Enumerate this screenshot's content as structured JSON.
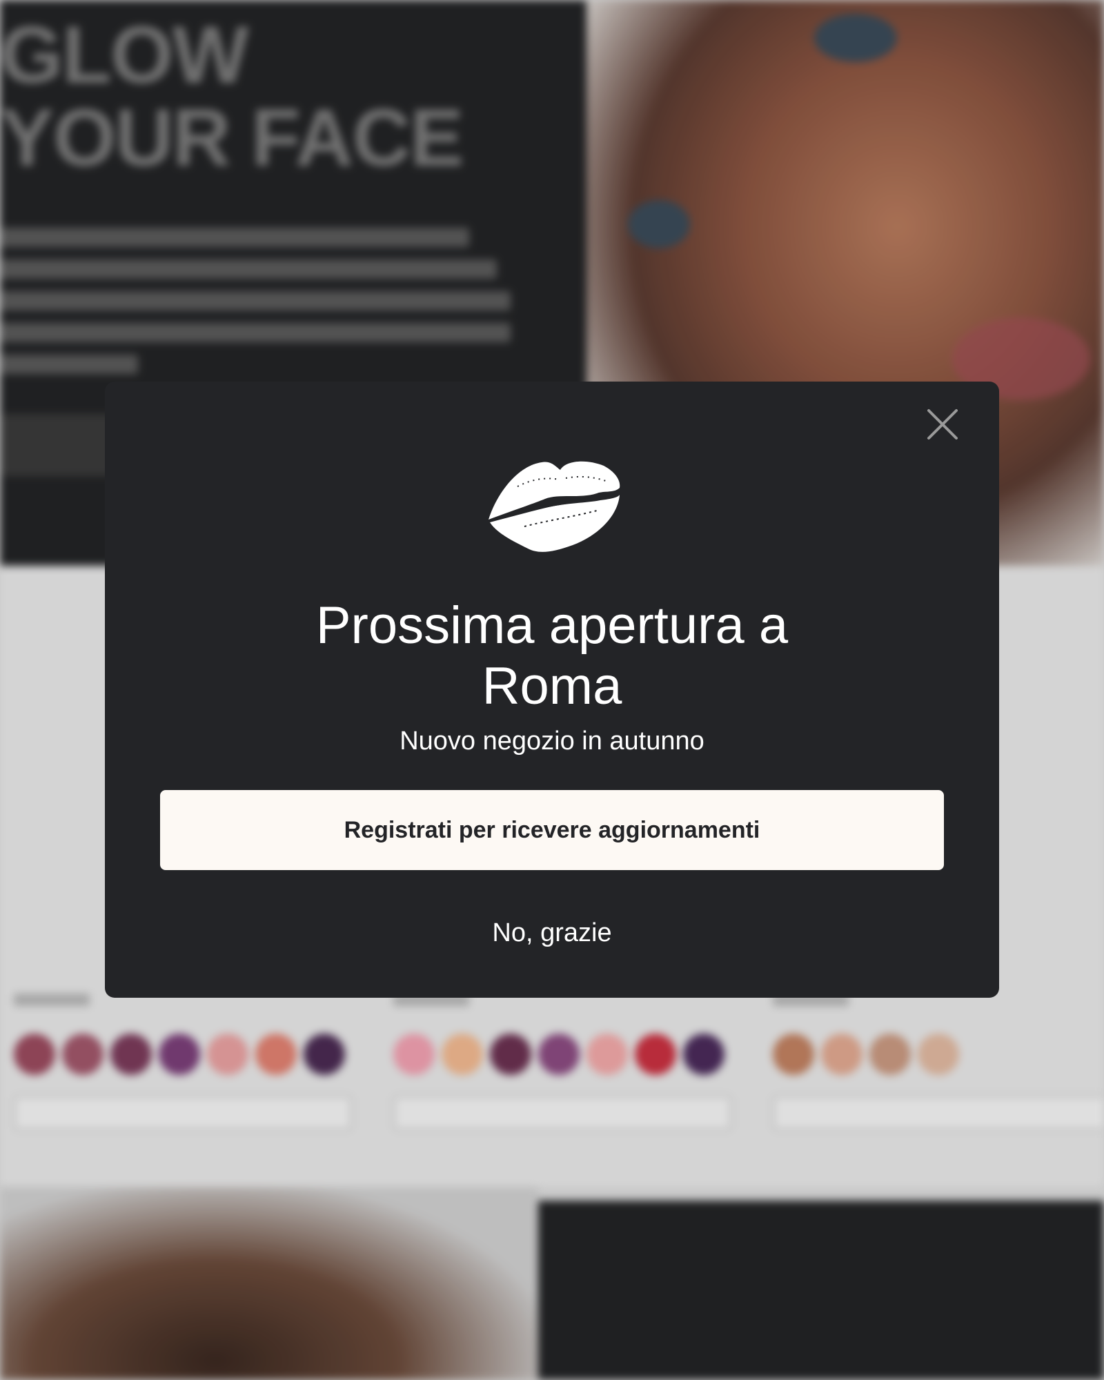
{
  "background": {
    "hero_title_line1": "GLOW",
    "hero_title_line2": "YOUR FACE"
  },
  "modal": {
    "title_line1": "Prossima apertura a",
    "title_line2": "Roma",
    "subtitle": "Nuovo negozio in autunno",
    "register_label": "Registrati per ricevere aggiornamenti",
    "decline_label": "No, grazie",
    "close_icon": "close-icon",
    "logo_icon": "kiss-lips-icon"
  },
  "colors": {
    "modal_bg": "#232427",
    "button_bg": "#fdf9f4",
    "text": "#ffffff"
  }
}
